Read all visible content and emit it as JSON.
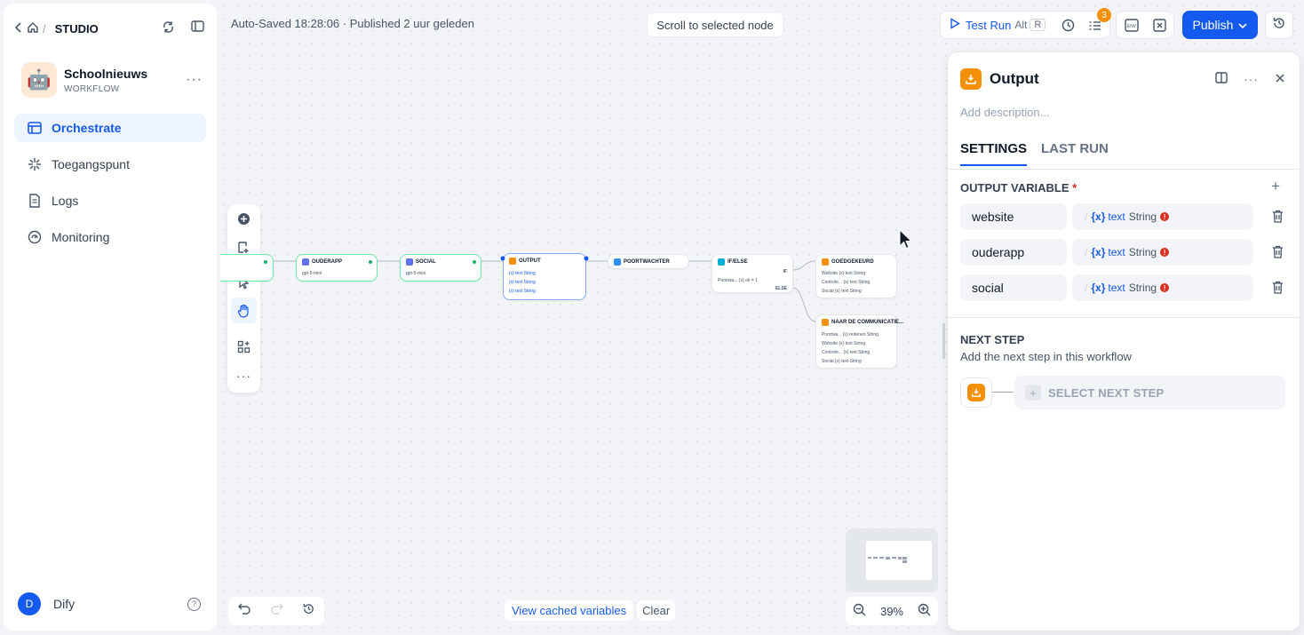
{
  "sidebar": {
    "breadcrumb": "STUDIO",
    "app": {
      "name": "Schoolnieuws",
      "kind": "WORKFLOW",
      "emoji": "🤖"
    },
    "items": [
      {
        "label": "Orchestrate",
        "icon": "layout-icon",
        "active": true
      },
      {
        "label": "Toegangspunt",
        "icon": "sparkle-icon",
        "active": false
      },
      {
        "label": "Logs",
        "icon": "document-icon",
        "active": false
      },
      {
        "label": "Monitoring",
        "icon": "gauge-icon",
        "active": false
      }
    ],
    "user": {
      "initial": "D",
      "name": "Dify"
    }
  },
  "header": {
    "status": "Auto-Saved 18:28:06 · Published 2 uur geleden",
    "scroll_to_selected": "Scroll to selected node",
    "test_run": "Test Run",
    "shortcut_alt": "Alt",
    "shortcut_key": "R",
    "checklist_count": "3",
    "env_label": "ENV",
    "publish": "Publish"
  },
  "canvas": {
    "nodes": [
      {
        "title": "OUDERAPP",
        "sub": "gpt-5-mini"
      },
      {
        "title": "SOCIAL",
        "sub": "gpt-5-mini"
      },
      {
        "title": "OUTPUT",
        "rows": [
          "{x} text String",
          "{x} text String",
          "{x} text String"
        ]
      },
      {
        "title": "POORTWACHTER"
      },
      {
        "title": "IF/ELSE",
        "if_label": "IF",
        "else_label": "ELSE",
        "cond": "Poortwa... {x} ok = 1"
      },
      {
        "title": "GOEDGEKEURD",
        "rows": [
          "Website {x} text String",
          "Controle... {x} text String",
          "Social {x} text String"
        ]
      },
      {
        "title": "NAAR DE COMMUNICATIE...",
        "rows": [
          "Poortwa... {x} redenen String",
          "Website {x} text String",
          "Controle... {x} text String",
          "Social {x} text String"
        ]
      }
    ],
    "cached": {
      "view": "View cached variables",
      "clear": "Clear"
    },
    "zoom": "39%"
  },
  "panel": {
    "title": "Output",
    "description_placeholder": "Add description...",
    "tabs": [
      "SETTINGS",
      "LAST RUN"
    ],
    "output_variable_title": "OUTPUT VARIABLE",
    "required_mark": "*",
    "variables": [
      {
        "name": "website",
        "value_name": "text",
        "value_type": "String"
      },
      {
        "name": "ouderapp",
        "value_name": "text",
        "value_type": "String"
      },
      {
        "name": "social",
        "value_name": "text",
        "value_type": "String"
      }
    ],
    "next_step_title": "NEXT STEP",
    "next_step_sub": "Add the next step in this workflow",
    "select_next": "SELECT NEXT STEP"
  },
  "colors": {
    "accent": "#155aef",
    "output_node": "#f79009",
    "ok_border": "#6ce9a6"
  }
}
